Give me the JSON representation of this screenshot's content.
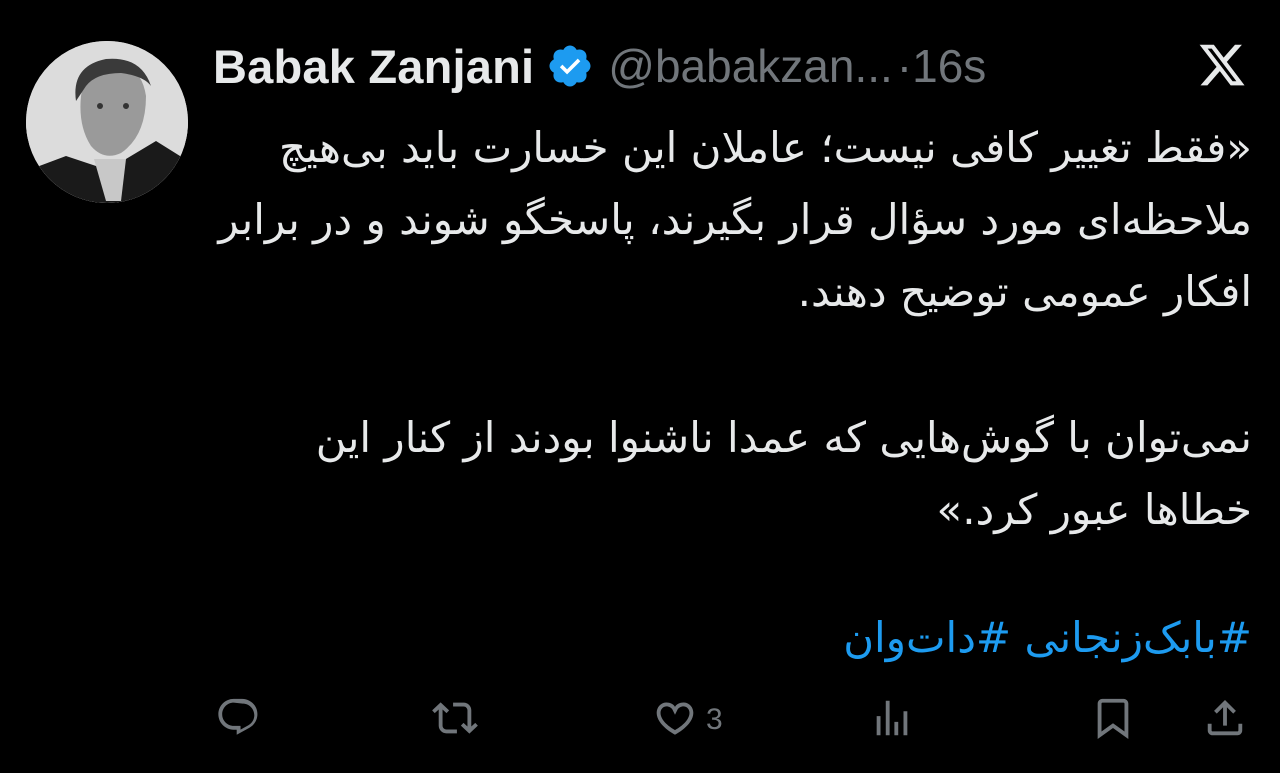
{
  "author": {
    "name": "Babak Zanjani",
    "handle": "@babakzan...",
    "separator": "·",
    "time": "16s"
  },
  "tweet": {
    "paragraph1": "«فقط تغییر کافی نیست؛ عاملان این خسارت باید بی‌هیچ ملاحظه‌ای مورد سؤال قرار بگیرند، پاسخگو شوند و در برابر افکار عمومی توضیح دهند.",
    "paragraph2": "نمی‌توان با گوش‌هایی که عمدا ناشنوا بودند از کنار این خطاها عبور کرد.»",
    "hashtags": "#بابک‌زنجانی #دات‌وان"
  },
  "actions": {
    "likes": "3"
  },
  "icons": {
    "verified": "verified-badge-icon",
    "logo": "x-logo-icon",
    "reply": "reply-icon",
    "retweet": "retweet-icon",
    "like": "heart-icon",
    "views": "views-icon",
    "bookmark": "bookmark-icon",
    "share": "share-icon"
  },
  "colors": {
    "background": "#000000",
    "text": "#e7e9ea",
    "muted": "#71767b",
    "accent": "#1d9bf0"
  }
}
